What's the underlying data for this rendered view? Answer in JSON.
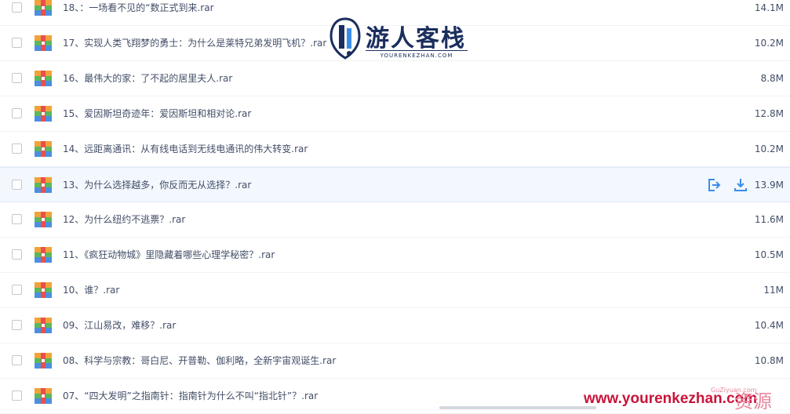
{
  "files": [
    {
      "name": "18、：一场看不见的“数正式到来.rar",
      "size": "14.1M"
    },
    {
      "name": "17、实现人类飞翔梦的勇士：为什么是莱特兄弟发明飞机？.rar",
      "size": "10.2M"
    },
    {
      "name": "16、最伟大的家：了不起的居里夫人.rar",
      "size": "8.8M"
    },
    {
      "name": "15、爱因斯坦奇迹年：爱因斯坦和相对论.rar",
      "size": "12.8M"
    },
    {
      "name": "14、远距离通讯：从有线电话到无线电通讯的伟大转变.rar",
      "size": "10.2M"
    },
    {
      "name": "13、为什么选择越多，你反而无从选择？.rar",
      "size": "13.9M"
    },
    {
      "name": "12、为什么纽约不逃票？.rar",
      "size": "11.6M"
    },
    {
      "name": "11、《疯狂动物城》里隐藏着哪些心理学秘密？.rar",
      "size": "10.5M"
    },
    {
      "name": "10、谁？.rar",
      "size": "11M"
    },
    {
      "name": "09、江山易改，难移？.rar",
      "size": "10.4M"
    },
    {
      "name": "08、科学与宗教：哥白尼、开普勒、伽利略，全新宇宙观诞生.rar",
      "size": "10.8M"
    },
    {
      "name": "07、“四大发明”之指南针：指南针为什么不叫“指北针”？.rar",
      "size": ""
    }
  ],
  "logo": {
    "title": "游人客栈",
    "subtitle": "YOURENKEZHAN.COM"
  },
  "watermark": {
    "url": "www.yourenkezhan.com",
    "cn": "资源",
    "small": "GuZiyuan.com"
  },
  "icons": {
    "share": "share-icon",
    "download": "download-icon",
    "file": "archive-file-icon"
  },
  "colors": {
    "accent": "#3b8cea",
    "text": "#424e67"
  }
}
